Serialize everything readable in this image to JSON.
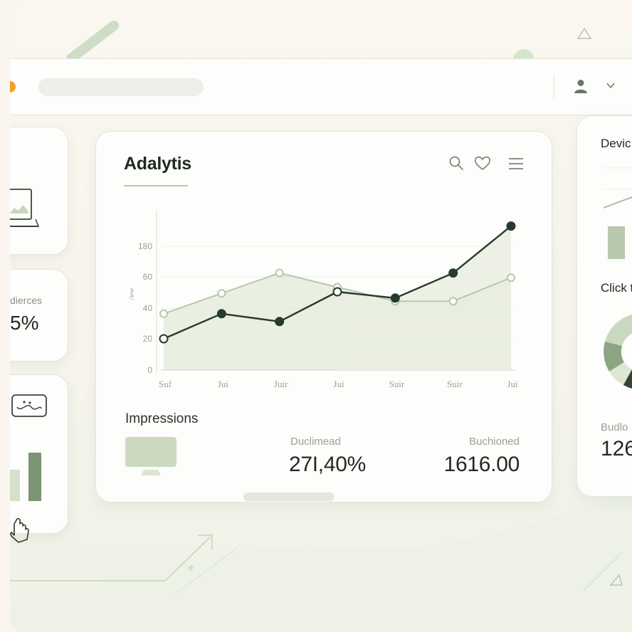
{
  "header": {
    "profile_menu": "user",
    "dropdown": "chevron-down"
  },
  "left_panels": {
    "audiences_label": "dierces",
    "audiences_value": "5%"
  },
  "analytics": {
    "title": "Adalytis",
    "toolbar_icons": [
      "search-icon",
      "heart-icon",
      "menu-icon"
    ],
    "impressions_label": "Impressions",
    "metric_1_label": "Duclimead",
    "metric_1_value": "27I,40%",
    "metric_2_label": "Buchioned",
    "metric_2_value": "1616.00"
  },
  "right_panel": {
    "devices_title": "Devic",
    "click_title": "Click t",
    "budget_label": "Budlo",
    "budget_value": "126"
  },
  "chart_data": {
    "type": "line",
    "categories": [
      "Suf",
      "Jui",
      "Juir",
      "Jui",
      "Suir",
      "Suir",
      "Jui"
    ],
    "y_ticks": [
      "0",
      "20",
      "40",
      "60",
      "180"
    ],
    "ylabel": "/ww",
    "series": [
      {
        "values": [
          20,
          36,
          31,
          50,
          46,
          62,
          92
        ]
      },
      {
        "values": [
          36,
          49,
          62,
          53,
          44,
          44,
          59
        ]
      }
    ],
    "colors": [
      "#263a2d",
      "#b7c8ae"
    ],
    "fill": "#dfe8d6",
    "grid": true
  }
}
